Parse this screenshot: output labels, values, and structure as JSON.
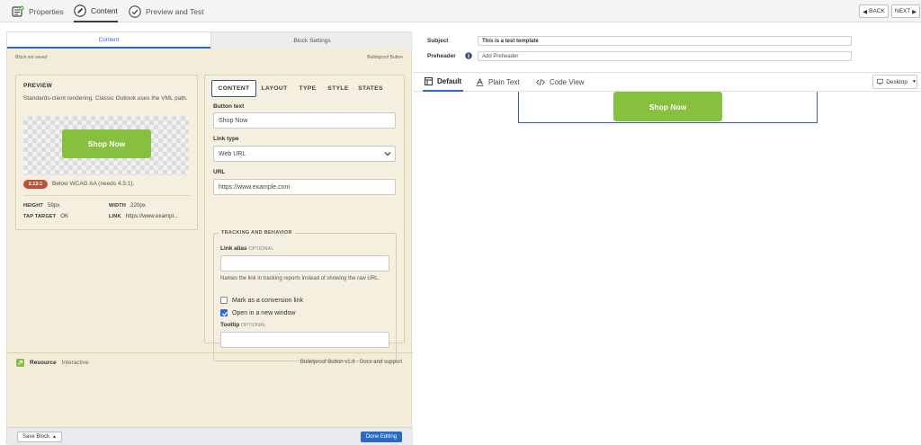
{
  "wizard": {
    "steps": [
      {
        "label": "Properties",
        "icon": "properties-icon"
      },
      {
        "label": "Content",
        "icon": "edit-pencil-icon"
      },
      {
        "label": "Preview and Test",
        "icon": "check-circle-icon"
      }
    ],
    "back_label": "BACK",
    "next_label": "NEXT"
  },
  "editor": {
    "tabs": [
      "Content",
      "Block Settings"
    ],
    "status": "Block not saved",
    "block_type": "Bulletproof Button"
  },
  "preview": {
    "title": "PREVIEW",
    "description": "Standards-client rendering. Classic Outlook uses the VML path.",
    "button_label": "Shop Now",
    "contrast_ratio": "2.12:1",
    "contrast_message": "Below WCAG AA (needs 4.5:1).",
    "height_label": "HEIGHT",
    "height_value": "59px",
    "width_label": "WIDTH",
    "width_value": "220px",
    "tap_label": "TAP TARGET",
    "tap_value": "OK",
    "link_label": "LINK",
    "link_value": "https://www.exampl..."
  },
  "settings": {
    "tabs": [
      "CONTENT",
      "LAYOUT",
      "TYPE",
      "STYLE",
      "STATES"
    ],
    "button_text_label": "Button text",
    "button_text_value": "Shop Now",
    "link_type_label": "Link type",
    "link_type_value": "Web URL",
    "url_label": "URL",
    "url_value": "https://www.example.com",
    "tracking_title": "TRACKING AND BEHAVIOR",
    "link_alias_label": "Link alias",
    "optional": "OPTIONAL",
    "link_alias_value": "",
    "link_alias_help": "Names the link in tracking reports instead of showing the raw URL.",
    "conversion_label": "Mark as a conversion link",
    "conversion_checked": false,
    "new_window_label": "Open in a new window",
    "new_window_checked": true,
    "tooltip_label": "Tooltip",
    "tooltip_value": ""
  },
  "resource": {
    "label": "Resource",
    "kind": "Interactive",
    "version_text": "Bulletproof Button v1.8 · Docs and support"
  },
  "footer": {
    "save_label": "Save Block",
    "done_label": "Done Editing"
  },
  "email": {
    "subject_label": "Subject",
    "subject_value": "This is a test template",
    "preheader_label": "Preheader",
    "preheader_placeholder": "Add Preheader"
  },
  "view_tabs": {
    "default": "Default",
    "plain_text": "Plain Text",
    "code_view": "Code View",
    "device": "Desktop"
  },
  "canvas": {
    "button_label": "Shop Now"
  },
  "colors": {
    "accent_blue": "#2a6ac6",
    "button_green": "#86c03e",
    "panel_beige": "#f3ecd9",
    "contrast_badge": "#b6553a"
  }
}
